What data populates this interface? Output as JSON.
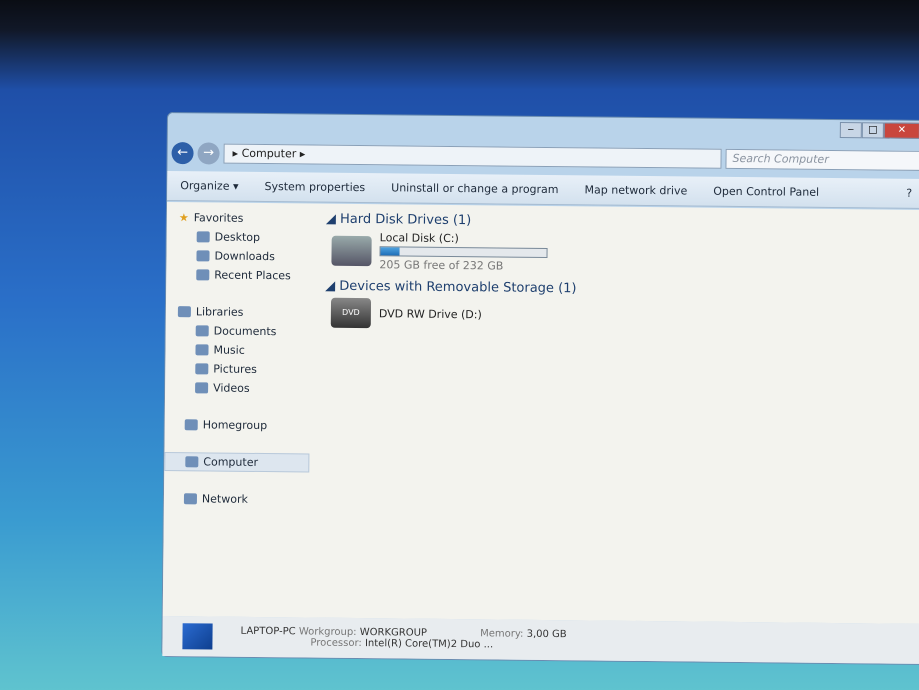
{
  "window": {
    "caption_min": "‒",
    "caption_max": "□",
    "caption_close": "✕"
  },
  "address": {
    "back": "←",
    "forward": "→",
    "path": "Computer",
    "search_placeholder": "Search Computer"
  },
  "toolbar": {
    "organize": "Organize ▾",
    "system_properties": "System properties",
    "uninstall": "Uninstall or change a program",
    "map_drive": "Map network drive",
    "control_panel": "Open Control Panel",
    "help": "?"
  },
  "sidebar": {
    "favorites": "Favorites",
    "desktop": "Desktop",
    "downloads": "Downloads",
    "recent": "Recent Places",
    "libraries": "Libraries",
    "documents": "Documents",
    "music": "Music",
    "pictures": "Pictures",
    "videos": "Videos",
    "homegroup": "Homegroup",
    "computer": "Computer",
    "network": "Network"
  },
  "main": {
    "hdd_group": "Hard Disk Drives (1)",
    "local_disk": "Local Disk (C:)",
    "local_disk_space": "205 GB free of 232 GB",
    "local_disk_used_percent": 11.6,
    "removable_group": "Devices with Removable Storage (1)",
    "dvd": "DVD RW Drive (D:)",
    "dvd_badge": "DVD"
  },
  "details": {
    "name": "LAPTOP-PC",
    "workgroup_label": "Workgroup:",
    "workgroup": "WORKGROUP",
    "memory_label": "Memory:",
    "memory": "3,00 GB",
    "processor_label": "Processor:",
    "processor": "Intel(R) Core(TM)2 Duo ..."
  }
}
